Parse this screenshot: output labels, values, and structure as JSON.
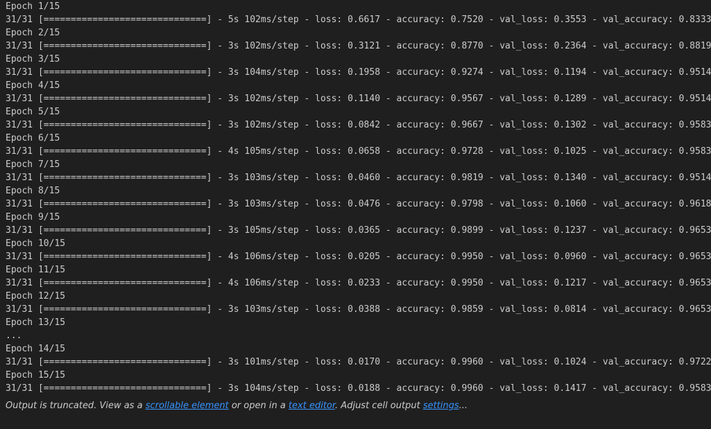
{
  "output": {
    "lines": [
      "Epoch 1/15",
      "31/31 [==============================] - 5s 102ms/step - loss: 0.6617 - accuracy: 0.7520 - val_loss: 0.3553 - val_accuracy: 0.8333",
      "Epoch 2/15",
      "31/31 [==============================] - 3s 102ms/step - loss: 0.3121 - accuracy: 0.8770 - val_loss: 0.2364 - val_accuracy: 0.8819",
      "Epoch 3/15",
      "31/31 [==============================] - 3s 104ms/step - loss: 0.1958 - accuracy: 0.9274 - val_loss: 0.1194 - val_accuracy: 0.9514",
      "Epoch 4/15",
      "31/31 [==============================] - 3s 102ms/step - loss: 0.1140 - accuracy: 0.9567 - val_loss: 0.1289 - val_accuracy: 0.9514",
      "Epoch 5/15",
      "31/31 [==============================] - 3s 102ms/step - loss: 0.0842 - accuracy: 0.9667 - val_loss: 0.1302 - val_accuracy: 0.9583",
      "Epoch 6/15",
      "31/31 [==============================] - 4s 105ms/step - loss: 0.0658 - accuracy: 0.9728 - val_loss: 0.1025 - val_accuracy: 0.9583",
      "Epoch 7/15",
      "31/31 [==============================] - 3s 103ms/step - loss: 0.0460 - accuracy: 0.9819 - val_loss: 0.1340 - val_accuracy: 0.9514",
      "Epoch 8/15",
      "31/31 [==============================] - 3s 103ms/step - loss: 0.0476 - accuracy: 0.9798 - val_loss: 0.1060 - val_accuracy: 0.9618",
      "Epoch 9/15",
      "31/31 [==============================] - 3s 105ms/step - loss: 0.0365 - accuracy: 0.9899 - val_loss: 0.1237 - val_accuracy: 0.9653",
      "Epoch 10/15",
      "31/31 [==============================] - 4s 106ms/step - loss: 0.0205 - accuracy: 0.9950 - val_loss: 0.0960 - val_accuracy: 0.9653",
      "Epoch 11/15",
      "31/31 [==============================] - 4s 106ms/step - loss: 0.0233 - accuracy: 0.9950 - val_loss: 0.1217 - val_accuracy: 0.9653",
      "Epoch 12/15",
      "31/31 [==============================] - 3s 103ms/step - loss: 0.0388 - accuracy: 0.9859 - val_loss: 0.0814 - val_accuracy: 0.9653",
      "Epoch 13/15",
      "...",
      "Epoch 14/15",
      "31/31 [==============================] - 3s 101ms/step - loss: 0.0170 - accuracy: 0.9960 - val_loss: 0.1024 - val_accuracy: 0.9722",
      "Epoch 15/15",
      "31/31 [==============================] - 3s 104ms/step - loss: 0.0188 - accuracy: 0.9960 - val_loss: 0.1417 - val_accuracy: 0.9583"
    ]
  },
  "footer": {
    "text_1": "Output is truncated. View as a ",
    "link_scrollable": "scrollable element",
    "text_2": " or open in a ",
    "link_editor": "text editor",
    "text_3": ". Adjust cell output ",
    "link_settings": "settings",
    "text_4": "..."
  },
  "colors": {
    "background": "#1f1f1f",
    "text": "#cccccc",
    "link": "#3794ff"
  }
}
